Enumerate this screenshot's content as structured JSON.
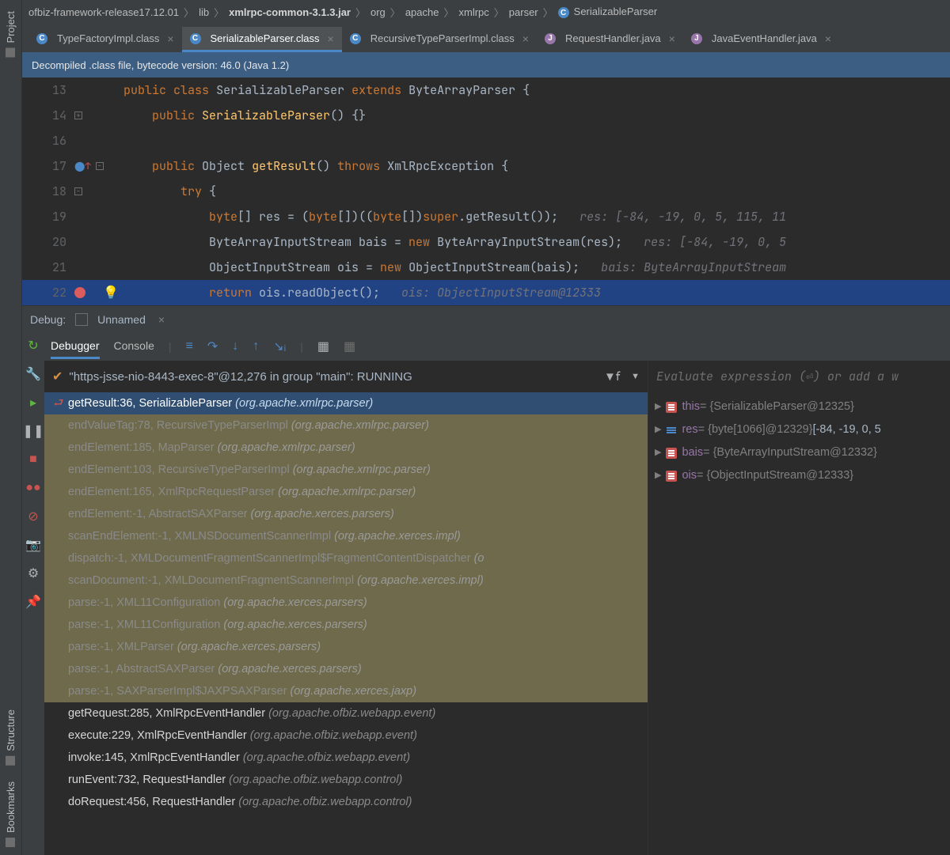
{
  "breadcrumbs": [
    "ofbiz-framework-release17.12.01",
    "lib",
    "xmlrpc-common-3.1.3.jar",
    "org",
    "apache",
    "xmlrpc",
    "parser",
    "SerializableParser"
  ],
  "tabs": [
    {
      "label": "TypeFactoryImpl.class",
      "icon": "c"
    },
    {
      "label": "SerializableParser.class",
      "icon": "c",
      "active": true
    },
    {
      "label": "RecursiveTypeParserImpl.class",
      "icon": "c"
    },
    {
      "label": "RequestHandler.java",
      "icon": "j"
    },
    {
      "label": "JavaEventHandler.java",
      "icon": "j"
    }
  ],
  "banner": "Decompiled .class file, bytecode version: 46.0 (Java 1.2)",
  "code": {
    "l13": {
      "n": "13",
      "t": "public class SerializableParser extends ByteArrayParser {"
    },
    "l14": {
      "n": "14",
      "t": "    public SerializableParser() {}"
    },
    "l16": {
      "n": "16"
    },
    "l17": {
      "n": "17",
      "t": "    public Object getResult() throws XmlRpcException {"
    },
    "l18": {
      "n": "18",
      "t": "        try {"
    },
    "l19": {
      "n": "19",
      "t": "            byte[] res = (byte[])((byte[])super.getResult());",
      "hint": "res: [-84, -19, 0, 5, 115, 11"
    },
    "l20": {
      "n": "20",
      "t": "            ByteArrayInputStream bais = new ByteArrayInputStream(res);",
      "hint": "res: [-84, -19, 0, 5"
    },
    "l21": {
      "n": "21",
      "t": "            ObjectInputStream ois = new ObjectInputStream(bais);",
      "hint": "bais: ByteArrayInputStream"
    },
    "l22": {
      "n": "22",
      "t": "            return ois.readObject();",
      "hint": "ois: ObjectInputStream@12333"
    }
  },
  "debug": {
    "label": "Debug:",
    "config": "Unnamed",
    "tabs": [
      "Debugger",
      "Console"
    ],
    "thread": "\"https-jsse-nio-8443-exec-8\"@12,276 in group \"main\": RUNNING",
    "eval_placeholder": "Evaluate expression (⏎) or add a w"
  },
  "frames": [
    {
      "m": "getResult:36, SerializableParser",
      "p": "(org.apache.xmlrpc.parser)",
      "sel": true,
      "icon": true
    },
    {
      "m": "endValueTag:78, RecursiveTypeParserImpl",
      "p": "(org.apache.xmlrpc.parser)",
      "dim": true
    },
    {
      "m": "endElement:185, MapParser",
      "p": "(org.apache.xmlrpc.parser)",
      "dim": true
    },
    {
      "m": "endElement:103, RecursiveTypeParserImpl",
      "p": "(org.apache.xmlrpc.parser)",
      "dim": true
    },
    {
      "m": "endElement:165, XmlRpcRequestParser",
      "p": "(org.apache.xmlrpc.parser)",
      "dim": true
    },
    {
      "m": "endElement:-1, AbstractSAXParser",
      "p": "(org.apache.xerces.parsers)",
      "dim": true
    },
    {
      "m": "scanEndElement:-1, XMLNSDocumentScannerImpl",
      "p": "(org.apache.xerces.impl)",
      "dim": true
    },
    {
      "m": "dispatch:-1, XMLDocumentFragmentScannerImpl$FragmentContentDispatcher",
      "p": "(o",
      "dim": true
    },
    {
      "m": "scanDocument:-1, XMLDocumentFragmentScannerImpl",
      "p": "(org.apache.xerces.impl)",
      "dim": true
    },
    {
      "m": "parse:-1, XML11Configuration",
      "p": "(org.apache.xerces.parsers)",
      "dim": true
    },
    {
      "m": "parse:-1, XML11Configuration",
      "p": "(org.apache.xerces.parsers)",
      "dim": true
    },
    {
      "m": "parse:-1, XMLParser",
      "p": "(org.apache.xerces.parsers)",
      "dim": true
    },
    {
      "m": "parse:-1, AbstractSAXParser",
      "p": "(org.apache.xerces.parsers)",
      "dim": true
    },
    {
      "m": "parse:-1, SAXParserImpl$JAXPSAXParser",
      "p": "(org.apache.xerces.jaxp)",
      "dim": true
    },
    {
      "m": "getRequest:285, XmlRpcEventHandler",
      "p": "(org.apache.ofbiz.webapp.event)"
    },
    {
      "m": "execute:229, XmlRpcEventHandler",
      "p": "(org.apache.ofbiz.webapp.event)"
    },
    {
      "m": "invoke:145, XmlRpcEventHandler",
      "p": "(org.apache.ofbiz.webapp.event)"
    },
    {
      "m": "runEvent:732, RequestHandler",
      "p": "(org.apache.ofbiz.webapp.control)"
    },
    {
      "m": "doRequest:456, RequestHandler",
      "p": "(org.apache.ofbiz.webapp.control)"
    }
  ],
  "vars": [
    {
      "name": "this",
      "val": " = {SerializableParser@12325}",
      "icon": "obj"
    },
    {
      "name": "res",
      "val": " = {byte[1066]@12329} ",
      "val2": "[-84, -19, 0, 5",
      "icon": "arr"
    },
    {
      "name": "bais",
      "val": " = {ByteArrayInputStream@12332}",
      "icon": "obj"
    },
    {
      "name": "ois",
      "val": " = {ObjectInputStream@12333}",
      "icon": "obj"
    }
  ],
  "sidetabs": {
    "project": "Project",
    "structure": "Structure",
    "bookmarks": "Bookmarks"
  }
}
